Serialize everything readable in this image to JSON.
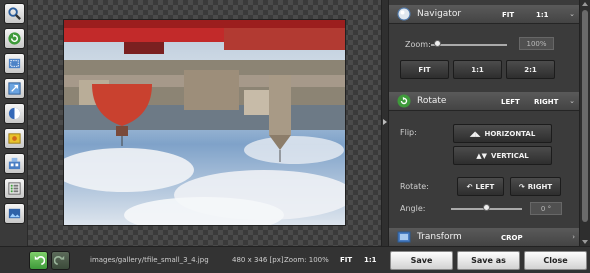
{
  "toolbar": {
    "tools": [
      {
        "icon": "zoom-icon"
      },
      {
        "icon": "rotate-icon"
      },
      {
        "icon": "crop-icon"
      },
      {
        "icon": "resize-icon"
      },
      {
        "icon": "adjust-icon"
      },
      {
        "icon": "effects-icon"
      },
      {
        "icon": "layers-icon"
      },
      {
        "icon": "list-icon"
      },
      {
        "icon": "frame-icon"
      }
    ]
  },
  "navigator": {
    "title": "Navigator",
    "fit_label": "FIT",
    "one_to_one_label": "1:1",
    "zoom_label": "Zoom:",
    "zoom_value": "100%",
    "zoom_level": 0.08,
    "buttons": [
      "FIT",
      "1:1",
      "2:1"
    ]
  },
  "rotate": {
    "title": "Rotate",
    "left_label": "LEFT",
    "right_label": "RIGHT",
    "flip_label": "Flip:",
    "horizontal_label": "HORIZONTAL",
    "vertical_label": "VERTICAL",
    "rotate_label": "Rotate:",
    "rotate_left": "LEFT",
    "rotate_right": "RIGHT",
    "angle_label": "Angle:",
    "angle_value": "0 °",
    "angle_level": 0.5
  },
  "transform": {
    "title": "Transform",
    "crop_label": "CROP"
  },
  "status": {
    "file_path": "images/gallery/tfile_small_3_4.jpg",
    "dimensions": "480 x 346 [px]",
    "zoom": "Zoom: 100%",
    "fit": "FIT",
    "one_to_one": "1:1"
  },
  "actions": {
    "save": "Save",
    "save_as": "Save as",
    "close": "Close"
  },
  "colors": {
    "accent_green": "#4caf50",
    "panel_bg": "#3b3b3b"
  }
}
